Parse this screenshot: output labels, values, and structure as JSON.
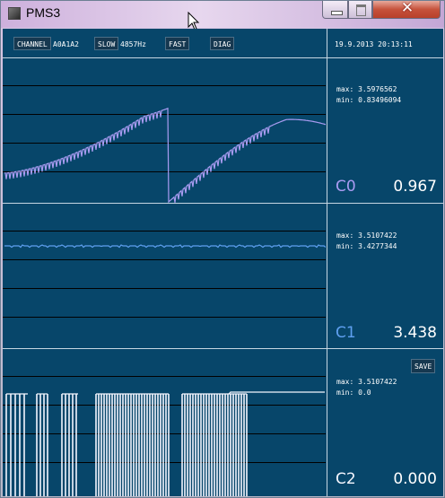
{
  "window": {
    "title": "PMS3"
  },
  "toolbar": {
    "channel_label": "CHANNEL",
    "channel_value": "A0A1A2",
    "slow_label": "SLOW",
    "rate": "4857Hz",
    "fast_label": "FAST",
    "diag_label": "DIAG"
  },
  "timestamp": "19.9.2013 20:13:11",
  "channels": [
    {
      "label": "C0",
      "value": "0.967",
      "max": "max: 3.5976562",
      "min": "min: 0.83496094",
      "color": "#aa9cf2"
    },
    {
      "label": "C1",
      "value": "3.438",
      "max": "max: 3.5107422",
      "min": "min: 3.4277344",
      "color": "#5fa0f0"
    },
    {
      "label": "C2",
      "value": "0.000",
      "max": "max: 3.5107422",
      "min": "min: 0.0",
      "color": "#f4f6ff"
    }
  ],
  "save_label": "SAVE",
  "colors": {
    "background": "#07466a",
    "grid": "#000000",
    "divider": "#c6d6e2"
  }
}
